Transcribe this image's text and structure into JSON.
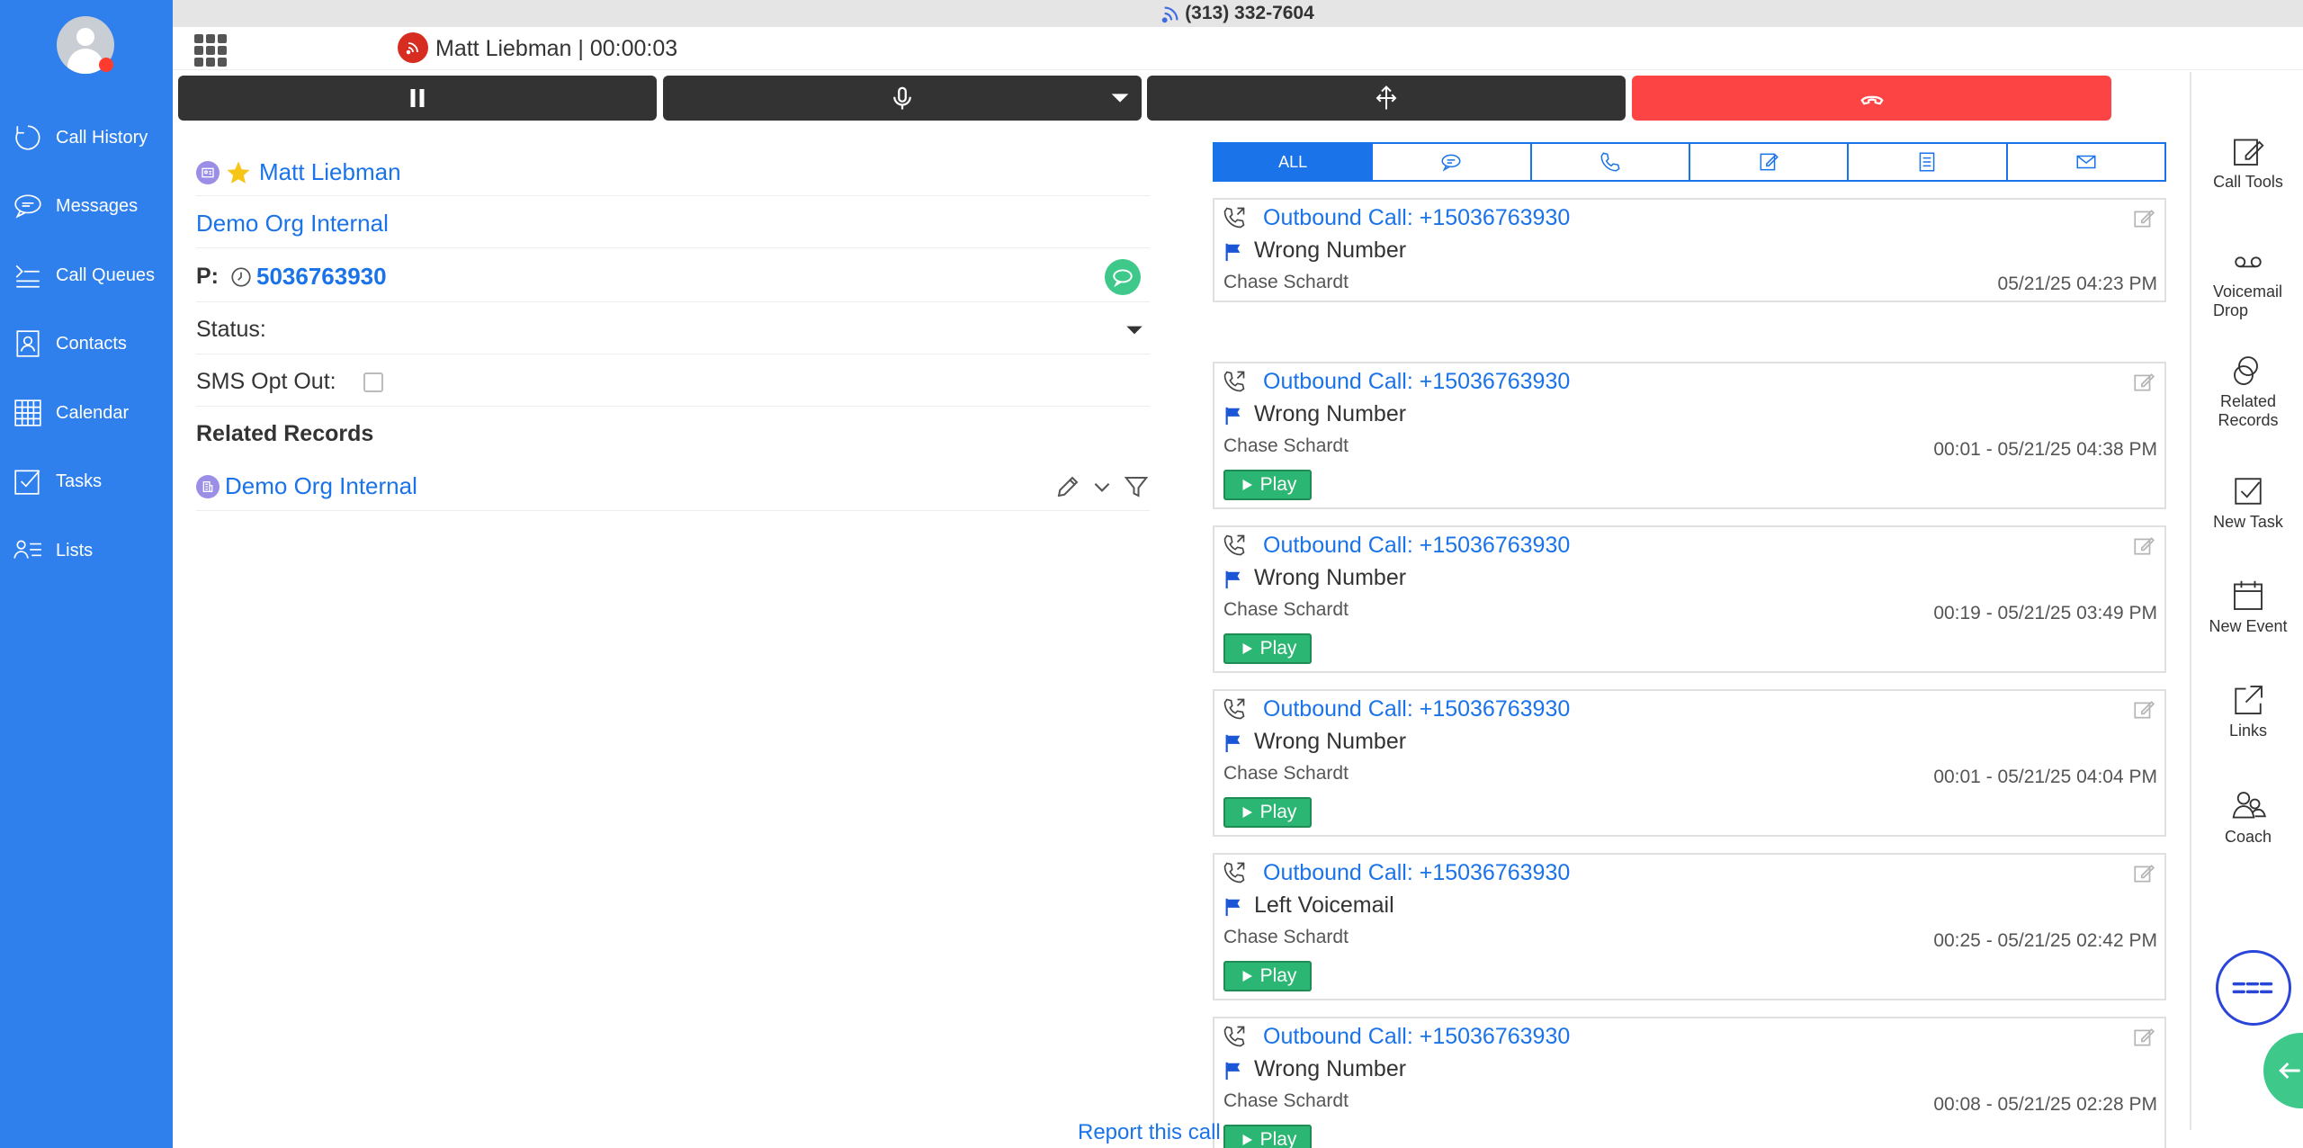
{
  "sidebar": {
    "items": [
      {
        "label": "Call History",
        "icon": "refresh-circle-icon"
      },
      {
        "label": "Messages",
        "icon": "chat-bubble-icon"
      },
      {
        "label": "Call Queues",
        "icon": "queue-arrows-icon"
      },
      {
        "label": "Contacts",
        "icon": "contact-card-icon"
      },
      {
        "label": "Calendar",
        "icon": "calendar-grid-icon"
      },
      {
        "label": "Tasks",
        "icon": "task-check-icon"
      },
      {
        "label": "Lists",
        "icon": "list-people-icon"
      }
    ]
  },
  "topbar": {
    "line_number": "(313) 332-7604",
    "caller": "Matt Liebman | 00:00:03"
  },
  "contact": {
    "name": "Matt Liebman",
    "organization": "Demo Org Internal",
    "phone_label": "P:",
    "phone": "5036763930",
    "status_label": "Status:",
    "sms_opt_out_label": "SMS Opt Out:",
    "related_records_title": "Related Records",
    "related_record": "Demo Org Internal"
  },
  "activity": {
    "tabs": [
      {
        "label": "ALL",
        "icon": ""
      },
      {
        "label": "",
        "icon": "chat-icon"
      },
      {
        "label": "",
        "icon": "phone-icon"
      },
      {
        "label": "",
        "icon": "note-icon"
      },
      {
        "label": "",
        "icon": "document-icon"
      },
      {
        "label": "",
        "icon": "mail-icon"
      }
    ],
    "play_label": "Play",
    "entries": [
      {
        "title": "Outbound Call: +15036763930",
        "disposition": "Wrong Number",
        "agent": "Chase Schardt",
        "meta": "05/21/25 04:23 PM",
        "has_play": false
      },
      {
        "title": "Outbound Call: +15036763930",
        "disposition": "Wrong Number",
        "agent": "Chase Schardt",
        "meta": "00:01 - 05/21/25 04:38 PM",
        "has_play": true
      },
      {
        "title": "Outbound Call: +15036763930",
        "disposition": "Wrong Number",
        "agent": "Chase Schardt",
        "meta": "00:19 - 05/21/25 03:49 PM",
        "has_play": true
      },
      {
        "title": "Outbound Call: +15036763930",
        "disposition": "Wrong Number",
        "agent": "Chase Schardt",
        "meta": "00:01 - 05/21/25 04:04 PM",
        "has_play": true
      },
      {
        "title": "Outbound Call: +15036763930",
        "disposition": "Left Voicemail",
        "agent": "Chase Schardt",
        "meta": "00:25 - 05/21/25 02:42 PM",
        "has_play": true
      },
      {
        "title": "Outbound Call: +15036763930",
        "disposition": "Wrong Number",
        "agent": "Chase Schardt",
        "meta": "00:08 - 05/21/25 02:28 PM",
        "has_play": true
      }
    ]
  },
  "rail": {
    "items": [
      {
        "label": "Call Tools",
        "icon": "call-tools-icon"
      },
      {
        "label": "Voicemail Drop",
        "icon": "voicemail-icon"
      },
      {
        "label": "Related Records",
        "icon": "related-records-icon"
      },
      {
        "label": "New Task",
        "icon": "new-task-icon"
      },
      {
        "label": "New Event",
        "icon": "new-event-icon"
      },
      {
        "label": "Links",
        "icon": "external-link-icon"
      },
      {
        "label": "Coach",
        "icon": "coach-icon"
      }
    ]
  },
  "footer": {
    "report_link": "Report this call"
  },
  "colors": {
    "sidebar": "#2f80ed",
    "link": "#1a73e8",
    "hangup": "#fc4444",
    "play": "#2bb673",
    "control": "#333333"
  }
}
